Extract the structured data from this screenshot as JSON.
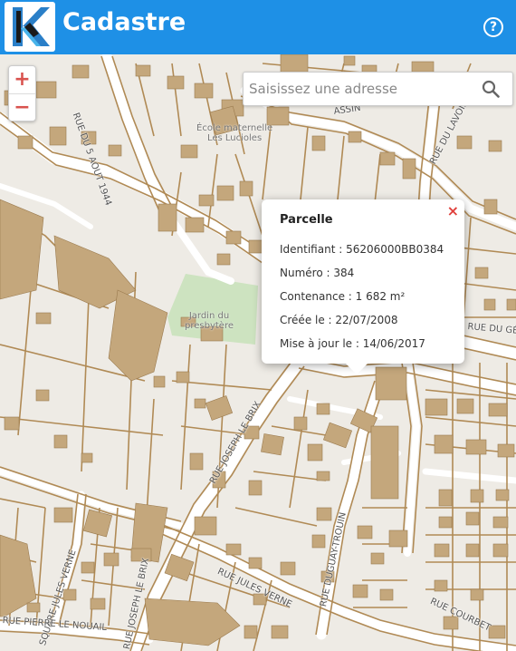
{
  "header": {
    "title": "Cadastre",
    "help_symbol": "?"
  },
  "zoom": {
    "in_label": "+",
    "out_label": "−"
  },
  "search": {
    "placeholder": "Saisissez une adresse"
  },
  "popup": {
    "title": "Parcelle",
    "close_symbol": "×",
    "rows": [
      "Identifiant : 56206000BB0384",
      "Numéro : 384",
      "Contenance : 1 682 m²",
      "Créée le : 22/07/2008",
      "Mise à jour le : 14/06/2017"
    ]
  },
  "map_labels": {
    "school_1": "École maternelle",
    "school_2": "Les Lucioles",
    "garden_1": "Jardin du",
    "garden_2": "presbytère",
    "rue_5_aout": "RUE DU 5 AOUT 1944",
    "rue_lavoir": "RUE DU LAVOIR",
    "assin": "ASSIN",
    "rue_ge": "RUE DU GÉ",
    "rue_joseph": "RUE JOSEPH LE BRIX",
    "rue_duguay": "RUE DUGUAY-TROUIN",
    "square_verne": "SQUARE JULES VERNE",
    "rue_verne": "RUE JULES VERNE",
    "rue_courbet": "RUE COURBET",
    "rue_nouail": "RUE PIERRE LE NOUAIL",
    "rue_brix_bottom": "RUE JOSEPH LE BRIX"
  },
  "colors": {
    "header": "#1e90e6",
    "building": "#c4a77c",
    "parcel_line": "#b08a55",
    "road": "#ffffff",
    "garden": "#cde3c0",
    "close": "#e0403c"
  }
}
